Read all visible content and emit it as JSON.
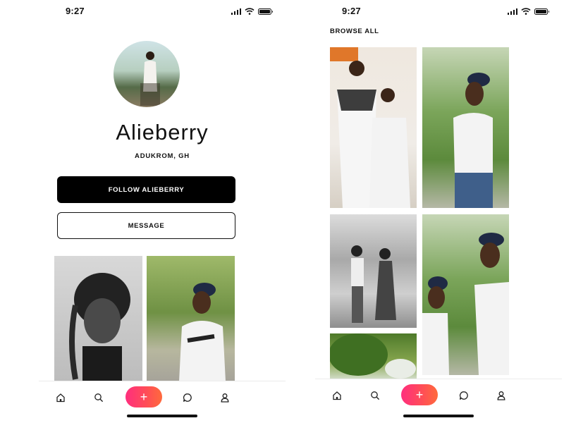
{
  "status_bar": {
    "time": "9:27"
  },
  "profile": {
    "name": "Alieberry",
    "location": "ADUKROM, GH",
    "follow_label": "FOLLOW ALIEBERRY",
    "message_label": "MESSAGE"
  },
  "browse": {
    "title": "BROWSE ALL"
  },
  "tab_bar": {
    "items": [
      "home-icon",
      "search-icon",
      "add-icon",
      "chat-bubble-icon",
      "user-icon"
    ],
    "add_symbol": "+",
    "accent_gradient": [
      "#ff2e7e",
      "#ff6a3c"
    ]
  },
  "colors": {
    "primary_button": "#000000",
    "text": "#111111",
    "background": "#ffffff"
  }
}
